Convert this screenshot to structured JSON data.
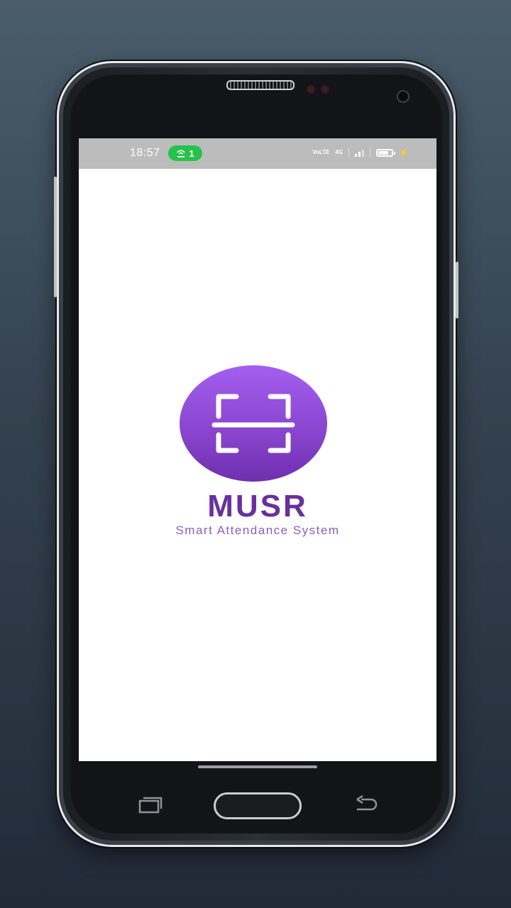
{
  "status_bar": {
    "time": "18:57",
    "hotspot_count": "1",
    "network_label_1": "VoLTE",
    "network_label_2": "4G",
    "accent_color": "#27c24c",
    "battery_level": 0.75
  },
  "app": {
    "name": "MUSR",
    "tagline": "Smart Attendance System",
    "logo_icon": "qr-scan-icon",
    "brand_color": "#6a2f9e",
    "logo_color": "#9a55e6"
  },
  "nav": {
    "recent_icon": "recent-apps-icon",
    "home_icon": "home-button",
    "back_icon": "back-icon"
  }
}
